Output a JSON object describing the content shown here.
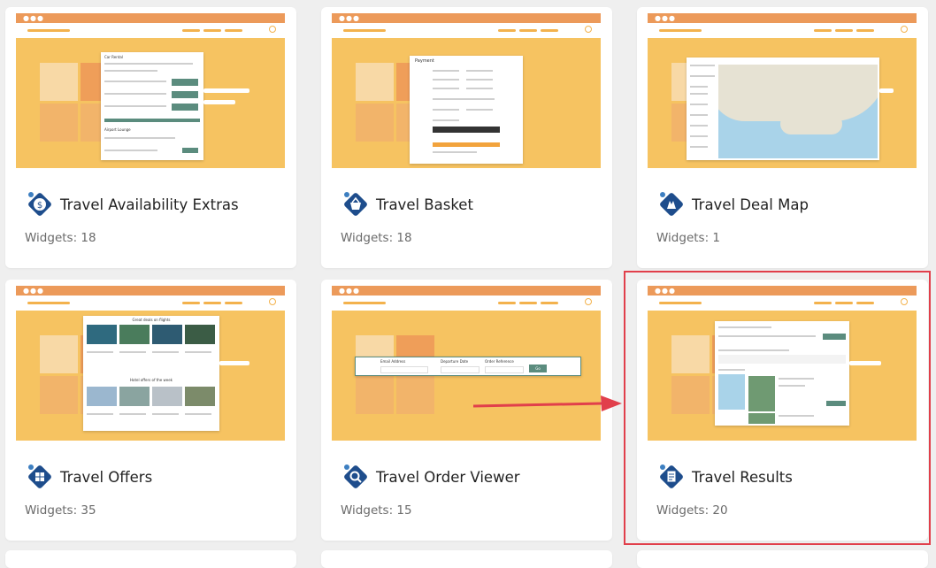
{
  "cards": [
    {
      "title": "Travel Availability Extras",
      "widgets": "Widgets: 18",
      "icon": "money-tag-icon"
    },
    {
      "title": "Travel Basket",
      "widgets": "Widgets: 18",
      "icon": "basket-tag-icon"
    },
    {
      "title": "Travel Deal Map",
      "widgets": "Widgets: 1",
      "icon": "map-tag-icon"
    },
    {
      "title": "Travel Offers",
      "widgets": "Widgets: 35",
      "icon": "grid-tag-icon"
    },
    {
      "title": "Travel Order Viewer",
      "widgets": "Widgets: 15",
      "icon": "magnifier-tag-icon"
    },
    {
      "title": "Travel Results",
      "widgets": "Widgets: 20",
      "icon": "document-tag-icon"
    }
  ],
  "previews": {
    "availability": {
      "heading": "Car Rental",
      "subheading": "Airport Lounge"
    },
    "basket": {
      "heading": "Payment"
    },
    "offers": {
      "heading": "Great deals on flights",
      "subheading": "Hotel offers of the week"
    },
    "order_viewer": {
      "fields": [
        "Email Address",
        "Departure Date",
        "Order Reference"
      ],
      "button": "Go"
    }
  },
  "colors": {
    "accent": "#f6c361",
    "brand": "#1e4d8c",
    "highlight": "#e13f4b",
    "arrow": "#e13f4b"
  }
}
